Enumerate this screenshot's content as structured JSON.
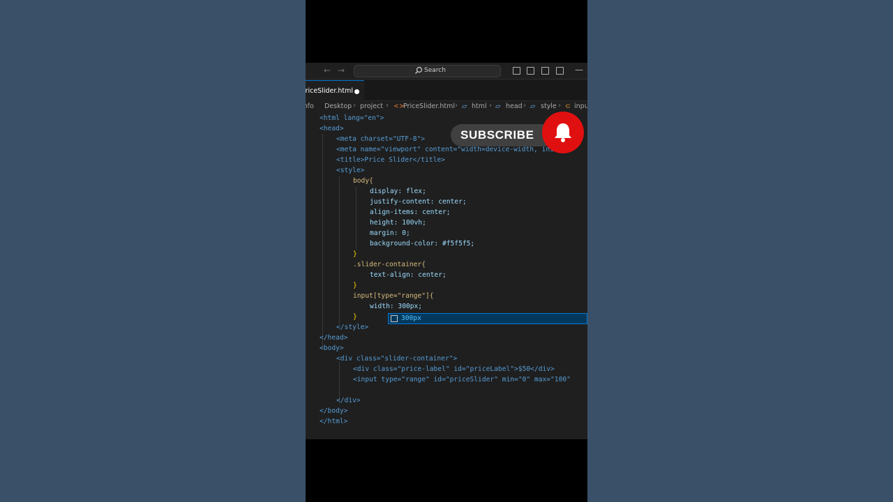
{
  "titlebar": {
    "search_label": "Search"
  },
  "tab": {
    "label": "PriceSlider.html"
  },
  "breadcrumb": [
    "info",
    "Desktop",
    "project",
    "PriceSlider.html",
    "html",
    "head",
    "style",
    "input"
  ],
  "code_lines": [
    "<html lang=\"en\">",
    "<head>",
    "<meta charset=\"UTF-8\">",
    "<meta name=\"viewport\" content=\"width=device-width, initial-",
    "<title>Price Slider</title>",
    "<style>",
    "body{",
    "display: flex;",
    "justify-content: center;",
    "align-items: center;",
    "height: 100vh;",
    "margin: 0;",
    "background-color: #f5f5f5;",
    "}",
    ".slider-container{",
    "text-align: center;",
    "}",
    "input[type=\"range\"]{",
    "width: 300px;",
    "}",
    "</style>",
    "</head>",
    "<body>",
    "<div class=\"slider-container\">",
    "<div class=\"price-label\" id=\"priceLabel\">$50</div>",
    "<input type=\"range\" id=\"priceSlider\" min=\"0\" max=\"100\"",
    "",
    "</div>",
    "</body>",
    "</html>"
  ],
  "autocomplete": {
    "suggestion": "300px"
  },
  "overlay": {
    "subscribe_label": "SUBSCRIBE"
  }
}
